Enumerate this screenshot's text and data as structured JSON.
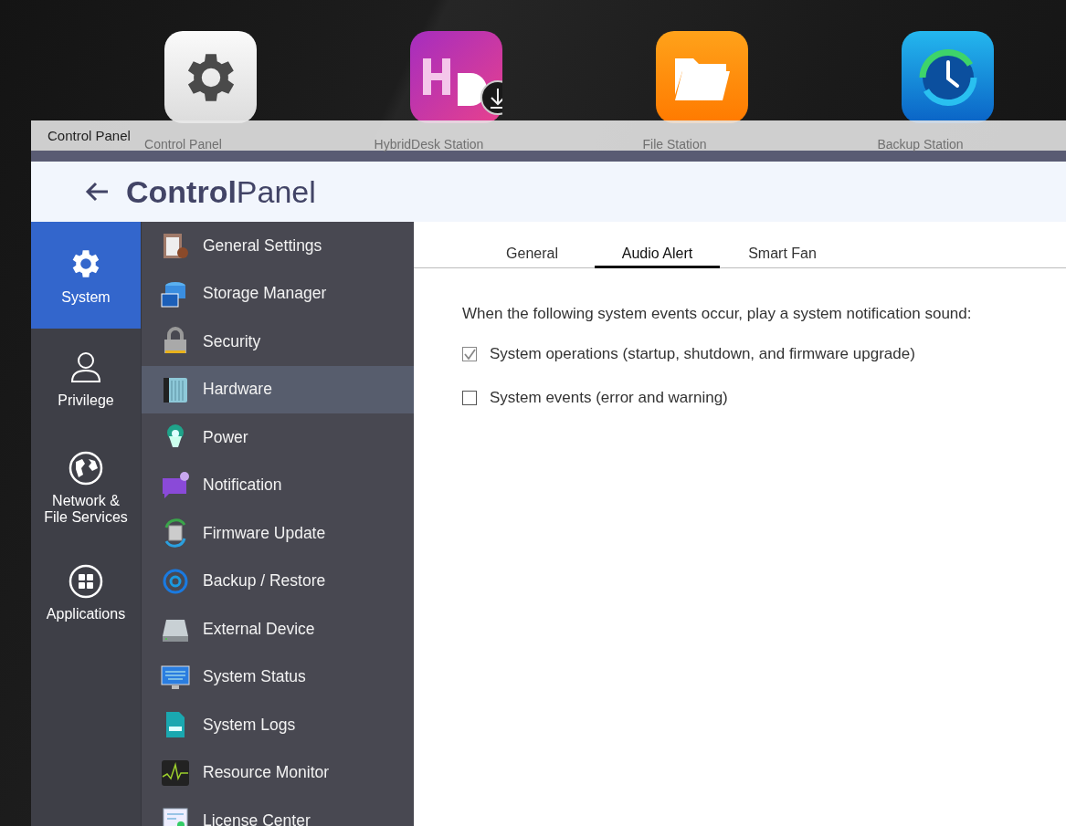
{
  "desktop_icons": [
    {
      "label": "Control Panel"
    },
    {
      "label": "HybridDesk Station"
    },
    {
      "label": "File Station"
    },
    {
      "label": "Backup Station"
    }
  ],
  "window": {
    "title": "Control Panel",
    "header_title": "**Control**Panel"
  },
  "categories": [
    {
      "label": "System",
      "selected": true
    },
    {
      "label": "Privilege",
      "selected": false
    },
    {
      "label": "Network &\nFile Services",
      "selected": false
    },
    {
      "label": "Applications",
      "selected": false
    }
  ],
  "menu": [
    {
      "label": "General Settings",
      "selected": false
    },
    {
      "label": "Storage Manager",
      "selected": false
    },
    {
      "label": "Security",
      "selected": false
    },
    {
      "label": "Hardware",
      "selected": true
    },
    {
      "label": "Power",
      "selected": false
    },
    {
      "label": "Notification",
      "selected": false
    },
    {
      "label": "Firmware Update",
      "selected": false
    },
    {
      "label": "Backup / Restore",
      "selected": false
    },
    {
      "label": "External Device",
      "selected": false
    },
    {
      "label": "System Status",
      "selected": false
    },
    {
      "label": "System Logs",
      "selected": false
    },
    {
      "label": "Resource Monitor",
      "selected": false
    },
    {
      "label": "License Center",
      "selected": false
    }
  ],
  "tabs": [
    {
      "label": "General",
      "selected": false
    },
    {
      "label": "Audio Alert",
      "selected": true
    },
    {
      "label": "Smart Fan",
      "selected": false
    }
  ],
  "intro": "When the following system events occur, play a system notification sound:",
  "options": [
    {
      "label": "System operations (startup, shutdown, and firmware upgrade)",
      "checked": true
    },
    {
      "label": "System events (error and warning)",
      "checked": false
    }
  ]
}
